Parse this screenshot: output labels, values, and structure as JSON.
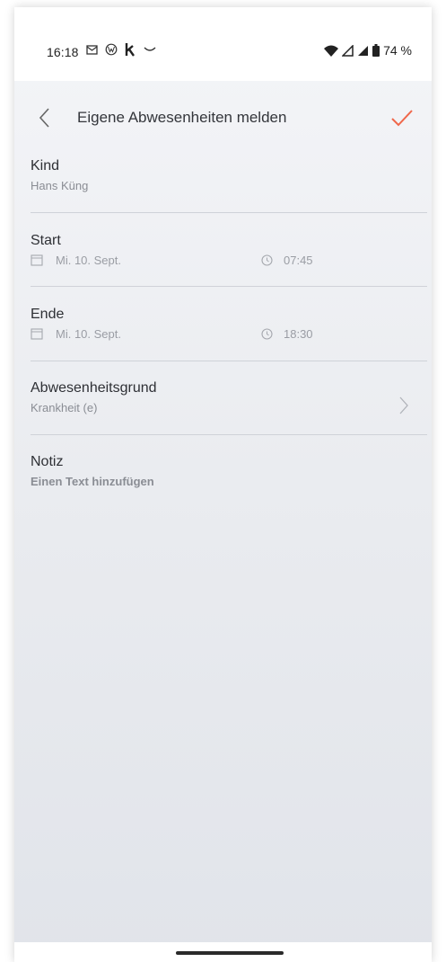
{
  "status_bar": {
    "time": "16:18",
    "battery": "74 %",
    "left_icons": [
      "mail-notification-icon",
      "vw-logo-icon",
      "k-app-icon",
      "smile-icon"
    ],
    "right_icons": [
      "wifi-icon",
      "signal-icon",
      "signal-icon",
      "battery-icon"
    ]
  },
  "header": {
    "title": "Eigene Abwesenheiten melden",
    "back_icon": "chevron-left-icon",
    "confirm_icon": "check-icon",
    "accent_color": "#f0674a"
  },
  "form": {
    "kind": {
      "label": "Kind",
      "value": "Hans Küng"
    },
    "start": {
      "label": "Start",
      "date": "Mi. 10. Sept.",
      "time": "07:45"
    },
    "ende": {
      "label": "Ende",
      "date": "Mi. 10. Sept.",
      "time": "18:30"
    },
    "grund": {
      "label": "Abwesenheitsgrund",
      "value": "Krankheit (e)"
    },
    "notiz": {
      "label": "Notiz",
      "placeholder": "Einen Text hinzufügen"
    }
  }
}
